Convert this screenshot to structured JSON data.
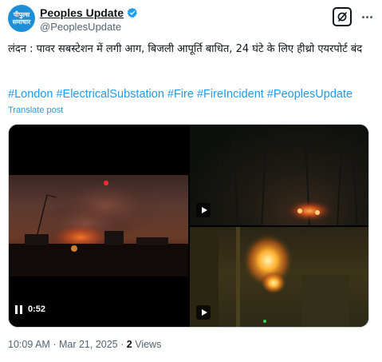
{
  "author": {
    "avatar_text_line1": "पीपुल्स",
    "avatar_text_line2": "समाचार",
    "display_name": "Peoples Update",
    "handle": "@PeoplesUpdate",
    "verified": true
  },
  "post": {
    "text": "लंदन : पावर सबस्टेशन में लगी आग, बिजली आपूर्ति बाधित, 24 घंटे के लिए हीथ्रो एयरपोर्ट बंद",
    "hashtags": "#London #ElectricalSubstation #Fire #FireIncident #PeoplesUpdate",
    "translate_label": "Translate post"
  },
  "media": {
    "video_time": "0:52",
    "colors": {
      "accent": "#1d9bf0",
      "text": "#0f1419",
      "muted": "#536471"
    }
  },
  "footer": {
    "time": "10:09 AM",
    "separator": "·",
    "date": "Mar 21, 2025",
    "views_count": "2",
    "views_label": "Views"
  },
  "icons": [
    "verified-badge-icon",
    "grok-icon",
    "more-icon",
    "pause-icon",
    "play-icon"
  ]
}
